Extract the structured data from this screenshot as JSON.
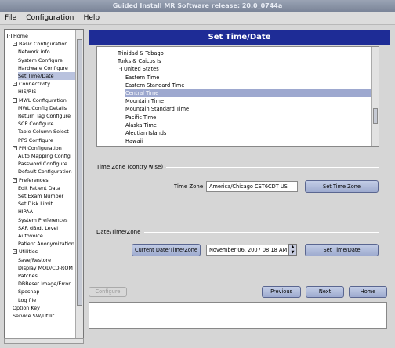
{
  "window_title": "Guided Install  MR Software release: 20.0_0744a",
  "menu": [
    "File",
    "Configuration",
    "Help"
  ],
  "tree": [
    {
      "label": "Home",
      "indent": 0,
      "expander": "-"
    },
    {
      "label": "Basic Configuration",
      "indent": 1,
      "expander": "-"
    },
    {
      "label": "Network info",
      "indent": 2
    },
    {
      "label": "System Configure",
      "indent": 2
    },
    {
      "label": "Hardware Configure",
      "indent": 2
    },
    {
      "label": "Set Time/Date",
      "indent": 2,
      "selected": true
    },
    {
      "label": "Connectivity",
      "indent": 1,
      "expander": "-"
    },
    {
      "label": "HIS/RIS",
      "indent": 2
    },
    {
      "label": "MWL Configuration",
      "indent": 1,
      "expander": "-"
    },
    {
      "label": "MWL Config Details",
      "indent": 2
    },
    {
      "label": "Return Tag Configure",
      "indent": 2
    },
    {
      "label": "SCP Configure",
      "indent": 2
    },
    {
      "label": "Table Column Select",
      "indent": 2
    },
    {
      "label": "PPS Configure",
      "indent": 2
    },
    {
      "label": "PM Configuration",
      "indent": 1,
      "expander": "-"
    },
    {
      "label": "Auto Mapping Config",
      "indent": 2
    },
    {
      "label": "Password Configure",
      "indent": 2
    },
    {
      "label": "Default Configuration",
      "indent": 2
    },
    {
      "label": "Preferences",
      "indent": 1,
      "expander": "-"
    },
    {
      "label": "Edit Patient Data",
      "indent": 2
    },
    {
      "label": "Set Exam Number",
      "indent": 2
    },
    {
      "label": "Set Disk Limit",
      "indent": 2
    },
    {
      "label": "HIPAA",
      "indent": 2
    },
    {
      "label": "System Preferences",
      "indent": 2
    },
    {
      "label": "SAR dB/dt Level",
      "indent": 2
    },
    {
      "label": "Autovoice",
      "indent": 2
    },
    {
      "label": "Patient Anonymization",
      "indent": 2
    },
    {
      "label": "Utilities",
      "indent": 1,
      "expander": "-"
    },
    {
      "label": "Save/Restore",
      "indent": 2
    },
    {
      "label": "Display MOD/CD-ROM",
      "indent": 2
    },
    {
      "label": "Patches",
      "indent": 2
    },
    {
      "label": "DBReset Image/Error",
      "indent": 2
    },
    {
      "label": "Spesnap",
      "indent": 2
    },
    {
      "label": "Log file",
      "indent": 2
    },
    {
      "label": "Option Key",
      "indent": 1
    },
    {
      "label": "Service SW/Utilit",
      "indent": 1
    }
  ],
  "page_title": "Set Time/Date",
  "timezones": [
    {
      "label": "Trinidad & Tobago",
      "indent": 1
    },
    {
      "label": "Turks & Caicos Is",
      "indent": 1
    },
    {
      "label": "United States",
      "indent": 1,
      "expander": "-"
    },
    {
      "label": "Eastern Time",
      "indent": 2
    },
    {
      "label": "Eastern Standard Time",
      "indent": 2
    },
    {
      "label": "Central Time",
      "indent": 2,
      "selected": true
    },
    {
      "label": "Mountain Time",
      "indent": 2
    },
    {
      "label": "Mountain Standard Time",
      "indent": 2
    },
    {
      "label": "Pacific Time",
      "indent": 2
    },
    {
      "label": "Alaska Time",
      "indent": 2
    },
    {
      "label": "Aleutian Islands",
      "indent": 2
    },
    {
      "label": "Hawaii",
      "indent": 2
    }
  ],
  "timezone_section": {
    "heading": "Time Zone (contry wise)",
    "label": "Time Zone",
    "value": "America/Chicago CST6CDT US",
    "button": "Set Time Zone"
  },
  "datetime_section": {
    "heading": "Date/Time/Zone",
    "current_button": "Current Date/Time/Zone",
    "value": "November 06, 2007 08:18 AM (",
    "button": "Set Time/Date"
  },
  "footer": {
    "configure": "Configure",
    "previous": "Previous",
    "next": "Next",
    "home": "Home"
  },
  "colors": {
    "title_bar": "#1e2c96",
    "selection": "#9da8cf",
    "button": "#b0bcdc"
  }
}
